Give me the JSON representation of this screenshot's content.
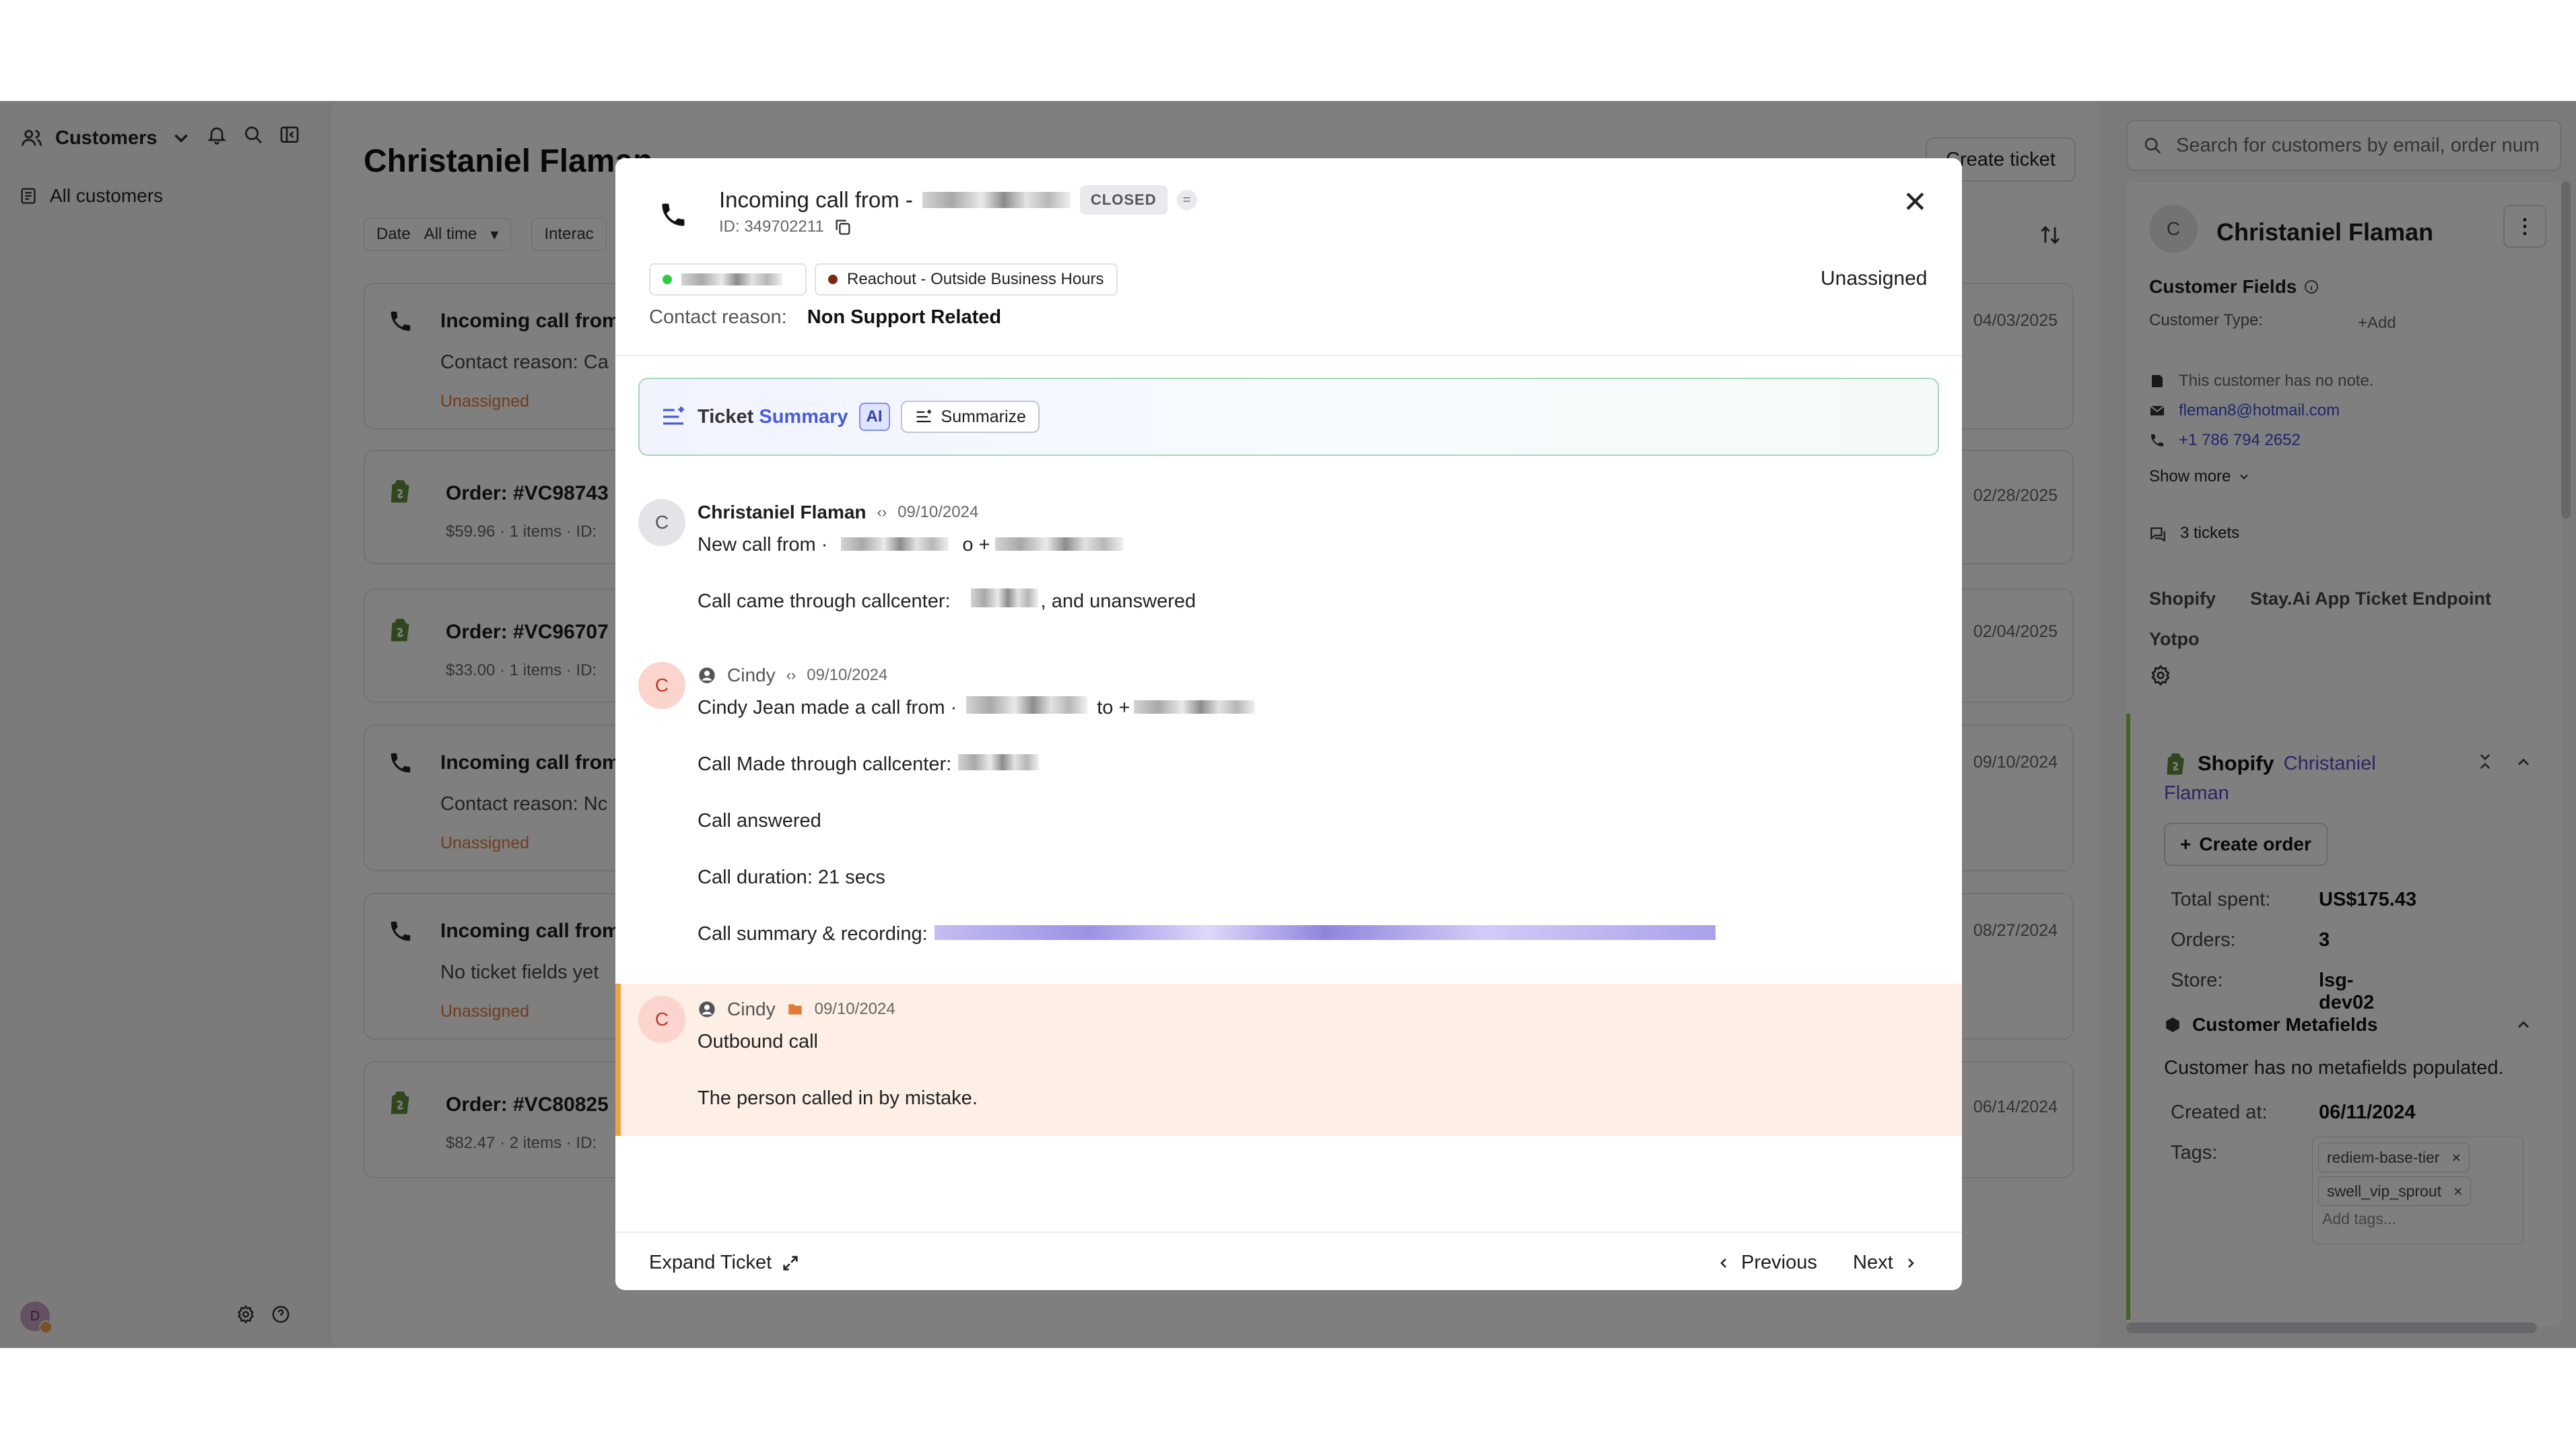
{
  "left_nav": {
    "section_label": "Customers",
    "item_all": "All customers",
    "avatar_initial": "D"
  },
  "center": {
    "page_title": "Christaniel Flaman",
    "create_ticket": "Create ticket",
    "filters": [
      {
        "label": "Date",
        "value": "All time"
      },
      {
        "label": "Interac",
        "value": ""
      }
    ],
    "cards": [
      {
        "kind": "call",
        "title": "Incoming call from -",
        "line1": "Contact reason: Ca",
        "assignee": "Unassigned",
        "date": "04/03/2025"
      },
      {
        "kind": "order",
        "title": "Order: #VC98743",
        "meta": "$59.96 · 1 items · ID:",
        "date": "02/28/2025"
      },
      {
        "kind": "order",
        "title": "Order: #VC96707",
        "meta": "$33.00 · 1 items · ID:",
        "date": "02/04/2025"
      },
      {
        "kind": "call",
        "title": "Incoming call from -",
        "line1": "Contact reason: Nc",
        "assignee": "Unassigned",
        "date": "09/10/2024"
      },
      {
        "kind": "call",
        "title": "Incoming call from -",
        "line1": "No ticket fields yet",
        "assignee": "Unassigned",
        "date": "08/27/2024"
      },
      {
        "kind": "order",
        "title": "Order: #VC80825",
        "meta": "$82.47 · 2 items · ID:",
        "date": "06/14/2024"
      }
    ]
  },
  "right_panel": {
    "search_placeholder": "Search for customers by email, order num",
    "avatar_initial": "C",
    "customer_name": "Christaniel Flaman",
    "customer_fields_title": "Customer Fields",
    "customer_type_label": "Customer Type:",
    "add_label": "+Add",
    "note": "This customer has no note.",
    "email": "fleman8@hotmail.com",
    "phone": "+1 786 794 2652",
    "show_more": "Show more",
    "tickets_count": "3 tickets",
    "integrations": [
      "Shopify",
      "Stay.Ai App Ticket Endpoint",
      "Yotpo"
    ],
    "shopify": {
      "title": "Shopify",
      "customer_link_1": "Christaniel",
      "customer_link_2": "Flaman",
      "create_order": "Create order",
      "total_spent_label": "Total spent:",
      "total_spent": "US$175.43",
      "orders_label": "Orders:",
      "orders": "3",
      "store_label": "Store:",
      "store": "lsg-dev02",
      "metafields_title": "Customer Metafields",
      "metafields_empty": "Customer has no metafields populated.",
      "created_label": "Created at:",
      "created_at": "06/11/2024",
      "tags_label": "Tags:",
      "tags": [
        "rediem-base-tier",
        "swell_vip_sprout"
      ],
      "add_tags": "Add tags..."
    }
  },
  "modal": {
    "title": "Incoming call from -",
    "status": "CLOSED",
    "id_text": "ID: 349702211",
    "chip_status": "Reachout - Outside Business Hours",
    "assignee": "Unassigned",
    "contact_reason_label": "Contact reason:",
    "contact_reason": "Non Support Related",
    "summary_label_1": "Ticket",
    "summary_label_2": "Summary",
    "ai_badge": "AI",
    "summarize_button": "Summarize",
    "messages": [
      {
        "initial": "C",
        "author": "Christaniel Flaman",
        "date": "09/10/2024",
        "lines": [
          "New call from ·",
          "Call came through callcenter:",
          ", and unanswered"
        ],
        "lines_extra": [
          "o +"
        ]
      },
      {
        "initial": "C",
        "author": "Cindy",
        "date": "09/10/2024",
        "lines": [
          "Cindy Jean made a call from ·",
          "Call Made through callcenter:",
          "Call answered",
          "Call duration: 21 secs",
          "Call summary & recording:"
        ],
        "lines_extra": [
          "to +"
        ]
      },
      {
        "initial": "C",
        "author": "Cindy",
        "date": "09/10/2024",
        "lines": [
          "Outbound call",
          "The person called in by mistake."
        ]
      }
    ],
    "expand_ticket": "Expand Ticket",
    "previous": "Previous",
    "next": "Next"
  },
  "colors": {
    "accent": "#4a5bd6",
    "unassigned": "#e07a3a",
    "highlight_bg": "#fdeee6",
    "highlight_border": "#f0a24a",
    "summary_border": "#a8d6b8",
    "link": "#3b4fd1"
  }
}
